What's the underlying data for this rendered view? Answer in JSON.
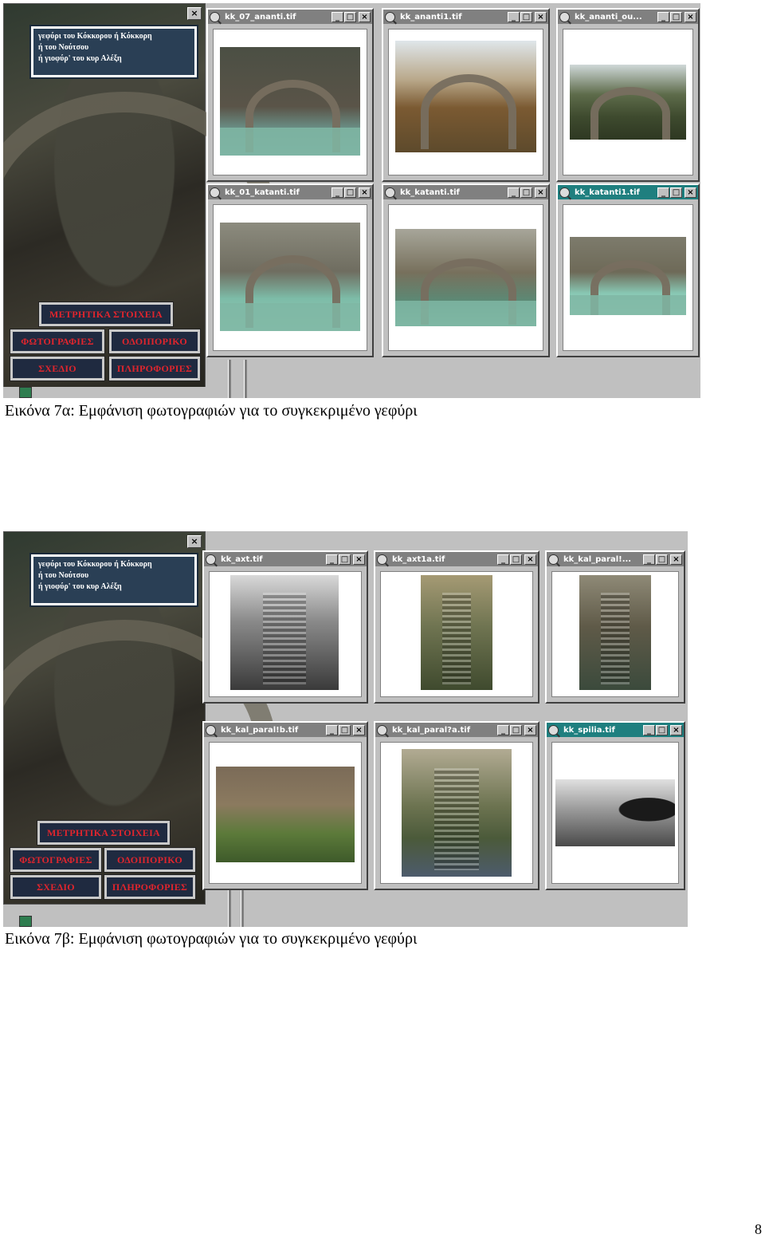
{
  "figure_a": {
    "caption": "Εικόνα 7α: Εμφάνιση φωτογραφιών για το συγκεκριμένο γεφύρι",
    "info_lines": [
      "γεφύρι του Κόκκορου ή Κόκκορη",
      "ή του Νούτσου",
      "ή γιοφύρ' του κυρ Αλέξη"
    ],
    "buttons": {
      "metrics": "ΜΕΤΡΗΤΙΚΑ ΣΤΟΙΧΕΙΑ",
      "photos": "ΦΩΤΟΓΡΑΦΙΕΣ",
      "route": "ΟΔΟΙΠΟΡΙΚΟ",
      "plan": "ΣΧΕΔΙΟ",
      "info": "ΠΛΗΡΟΦΟΡΙΕΣ"
    },
    "windows": [
      {
        "title": "kk_07_ananti.tif"
      },
      {
        "title": "kk_ananti1.tif"
      },
      {
        "title": "kk_ananti_ou..."
      },
      {
        "title": "kk_01_katanti.tif"
      },
      {
        "title": "kk_katanti.tif"
      },
      {
        "title": "kk_katanti1.tif"
      }
    ]
  },
  "figure_b": {
    "caption": "Εικόνα 7β: Εμφάνιση φωτογραφιών για το συγκεκριμένο γεφύρι",
    "info_lines": [
      "γεφύρι του Κόκκορου ή Κόκκορη",
      "ή του Νούτσου",
      "ή γιοφύρ' του κυρ Αλέξη"
    ],
    "buttons": {
      "metrics": "ΜΕΤΡΗΤΙΚΑ ΣΤΟΙΧΕΙΑ",
      "photos": "ΦΩΤΟΓΡΑΦΙΕΣ",
      "route": "ΟΔΟΙΠΟΡΙΚΟ",
      "plan": "ΣΧΕΔΙΟ",
      "info": "ΠΛΗΡΟΦΟΡΙΕΣ"
    },
    "windows": [
      {
        "title": "kk_axt.tif"
      },
      {
        "title": "kk_axt1a.tif"
      },
      {
        "title": "kk_kal_paral!..."
      },
      {
        "title": "kk_kal_paral!b.tif"
      },
      {
        "title": "kk_kal_paral?a.tif"
      },
      {
        "title": "kk_spilia.tif"
      }
    ]
  },
  "window_buttons": {
    "minimize": "_",
    "maximize": "□",
    "close": "×"
  },
  "page_number": "8",
  "colors": {
    "active_title": "#1f7f7f",
    "inactive_title": "#808080",
    "button_text": "#e0252d",
    "button_bg": "#1f2a40",
    "info_bg": "#2a3f55"
  }
}
